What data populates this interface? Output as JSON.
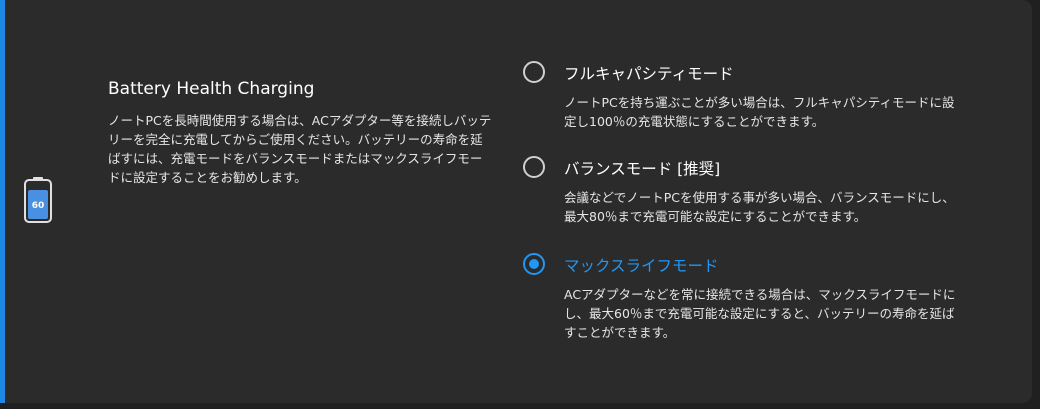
{
  "colors": {
    "accent": "#2196f3",
    "panel_background": "#2b2b2b",
    "page_background": "#202020",
    "text": "#ffffff"
  },
  "battery": {
    "icon": "battery-icon",
    "level": "60"
  },
  "section": {
    "title": "Battery Health Charging",
    "description": "ノートPCを長時間使用する場合は、ACアダプター等を接続しバッテリーを完全に充電してからご使用ください。バッテリーの寿命を延ばすには、充電モードをバランスモードまたはマックスライフモードに設定することをお勧めします。"
  },
  "options": [
    {
      "label": "フルキャパシティモード",
      "description": "ノートPCを持ち運ぶことが多い場合は、フルキャパシティモードに設定し100％の充電状態にすることができます。",
      "selected": false
    },
    {
      "label": "バランスモード [推奨]",
      "description": "会議などでノートPCを使用する事が多い場合、バランスモードにし、最大80％まで充電可能な設定にすることができます。",
      "selected": false
    },
    {
      "label": "マックスライフモード",
      "description": "ACアダプターなどを常に接続できる場合は、マックスライフモードにし、最大60％まで充電可能な設定にすると、バッテリーの寿命を延ばすことができます。",
      "selected": true
    }
  ]
}
